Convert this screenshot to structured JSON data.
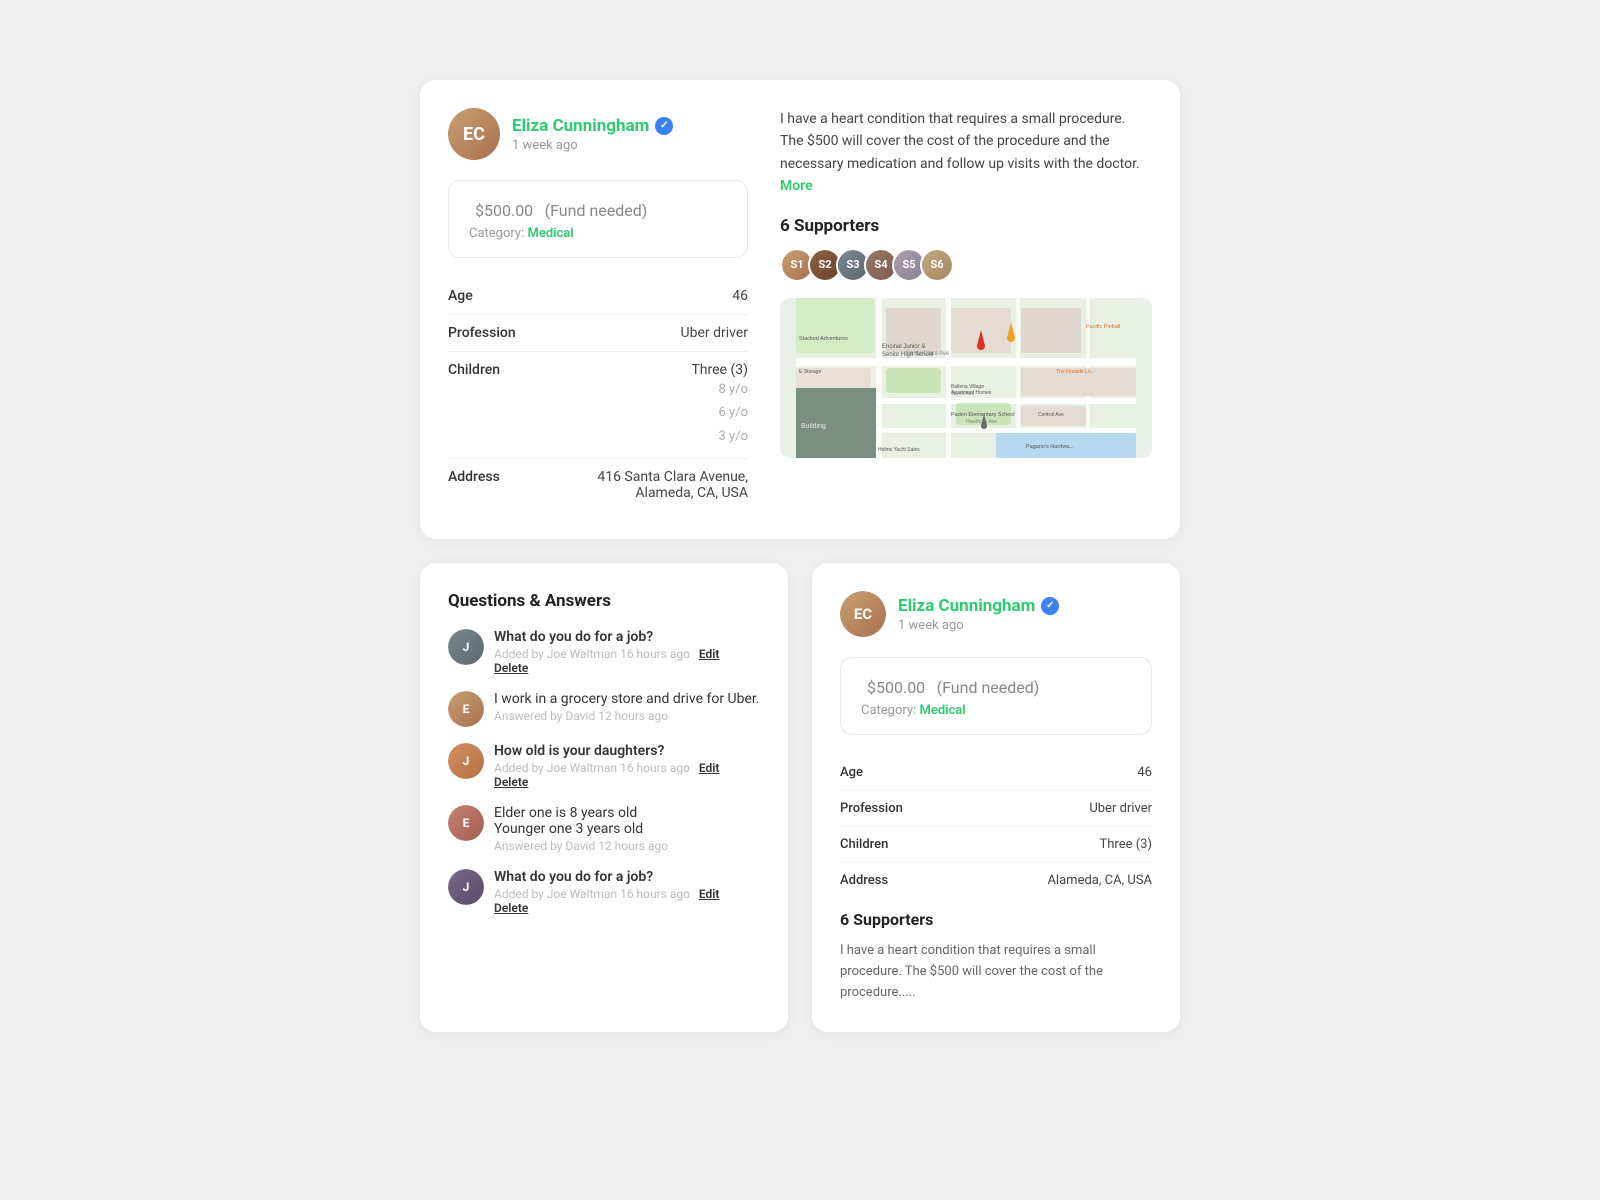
{
  "topCard": {
    "profile": {
      "name": "Eliza Cunningham",
      "time": "1 week ago",
      "verified": true
    },
    "fund": {
      "amount": "$500.00",
      "label": "(Fund needed)",
      "categoryLabel": "Category:",
      "categoryValue": "Medical"
    },
    "fields": [
      {
        "label": "Age",
        "value": "46",
        "sub": []
      },
      {
        "label": "Profession",
        "value": "Uber driver",
        "sub": []
      },
      {
        "label": "Children",
        "value": "Three (3)",
        "sub": [
          "8 y/o",
          "6 y/o",
          "3 y/o"
        ]
      },
      {
        "label": "Address",
        "value": "416 Santa Clara Avenue,",
        "sub2": "Alameda, CA, USA"
      }
    ],
    "description": "I have a heart condition that requires a small procedure. The $500 will cover the cost of the procedure and the necessary medication and follow up visits with the doctor.",
    "moreLabel": "More",
    "supportersTitle": "6 Supporters",
    "supportersCount": 6
  },
  "qaSection": {
    "title": "Questions & Answers",
    "items": [
      {
        "type": "question",
        "text": "What do you do for a job?",
        "meta": "Added by Joe Waltman 16 hours ago",
        "actions": [
          "Edit",
          "Delete"
        ]
      },
      {
        "type": "answer",
        "text": "I work in a grocery store and drive for Uber.",
        "meta": "Answered by David 12 hours ago",
        "actions": []
      },
      {
        "type": "question",
        "text": "How old is your daughters?",
        "meta": "Added by Joe Waltman 16 hours ago",
        "actions": [
          "Edit",
          "Delete"
        ]
      },
      {
        "type": "answer",
        "text": "Elder one is 8 years old Younger one 3 years old",
        "meta": "Answered by David 12 hours ago",
        "actions": []
      },
      {
        "type": "question",
        "text": "What do you do for a job?",
        "meta": "Added by Joe Waltman 16 hours ago",
        "actions": [
          "Edit",
          "Delete"
        ]
      }
    ]
  },
  "rightCard": {
    "profile": {
      "name": "Eliza Cunningham",
      "time": "1 week ago",
      "verified": true
    },
    "fund": {
      "amount": "$500.00",
      "label": "(Fund needed)",
      "categoryLabel": "Category:",
      "categoryValue": "Medical"
    },
    "fields": [
      {
        "label": "Age",
        "value": "46"
      },
      {
        "label": "Profession",
        "value": "Uber driver"
      },
      {
        "label": "Children",
        "value": "Three (3)"
      },
      {
        "label": "Address",
        "value": "Alameda, CA, USA"
      }
    ],
    "supportersTitle": "6 Supporters",
    "description": "I have a heart condition that requires a small procedure. The $500 will cover the cost of the procedure....."
  }
}
